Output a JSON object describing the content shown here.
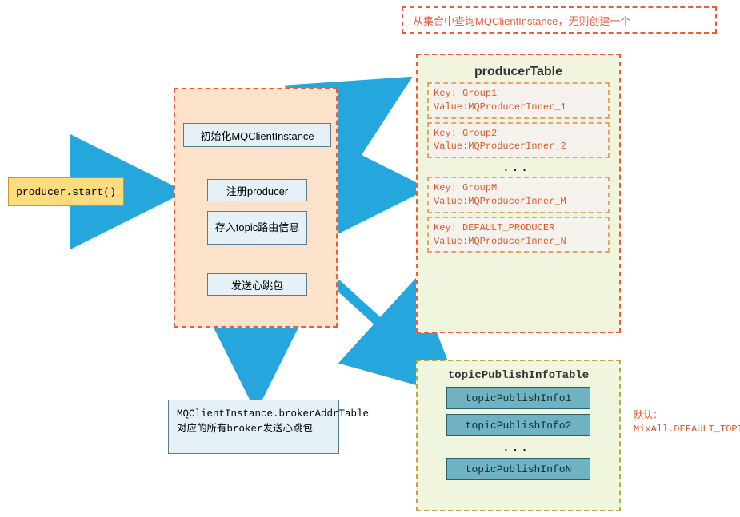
{
  "start": {
    "label": "producer.start()"
  },
  "main": {
    "step1": "初始化MQClientInstance",
    "step2": "注册producer",
    "step3": "存入topic路由信息",
    "step4": "发送心跳包"
  },
  "noteTop": "从集合中查询MQClientInstance，无则创建一个",
  "producerTable": {
    "title": "producerTable",
    "rows": [
      {
        "key": "Group1",
        "value": "MQProducerInner_1"
      },
      {
        "key": "Group2",
        "value": "MQProducerInner_2"
      },
      {
        "key": "GroupM",
        "value": "MQProducerInner_M"
      },
      {
        "key": "DEFAULT_PRODUCER",
        "value": "MQProducerInner_N"
      }
    ],
    "ellipsis": "..."
  },
  "topicTable": {
    "title": "topicPublishInfoTable",
    "items": [
      "topicPublishInfo1",
      "topicPublishInfo2",
      "topicPublishInfoN"
    ],
    "ellipsis": "..."
  },
  "heartBox": "MQClientInstance.brokerAddrTable对应的所有broker发送心跳包",
  "defaultNote": {
    "l1": "默认：",
    "l2": "MixAll.DEFAULT_TOPIC"
  }
}
